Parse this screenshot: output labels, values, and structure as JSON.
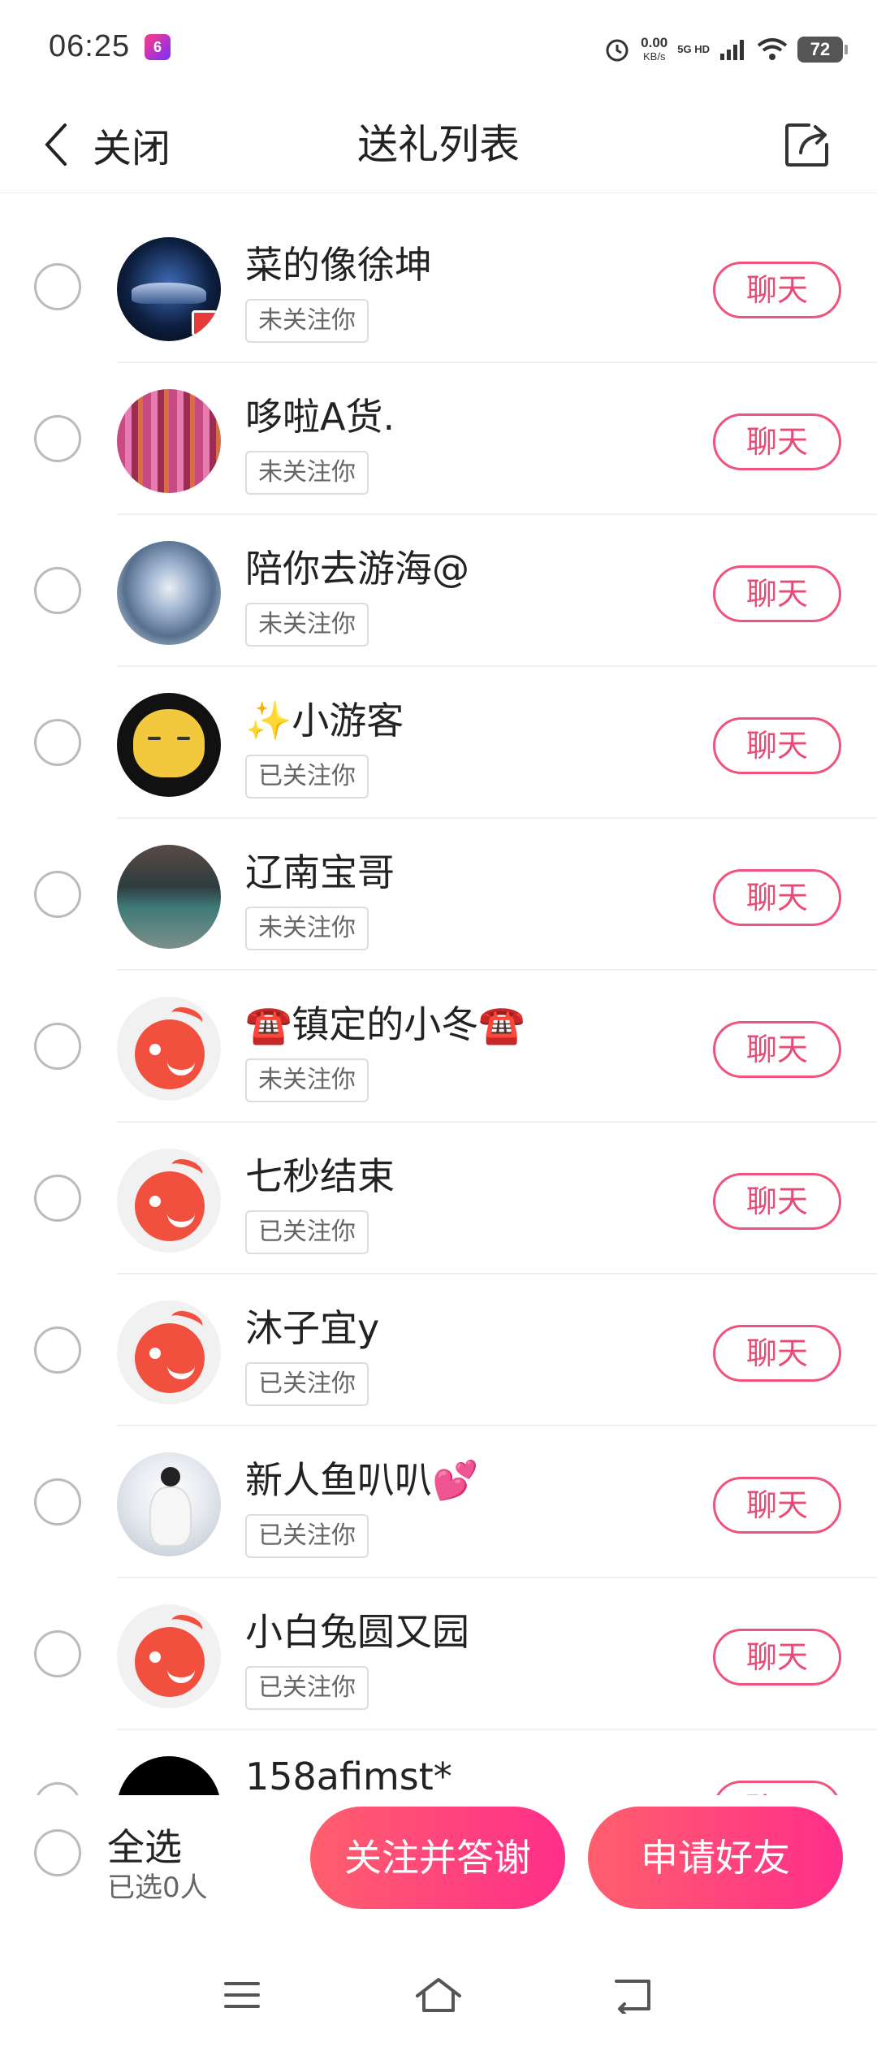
{
  "status_bar": {
    "time": "06:25",
    "app_icon_text": "6",
    "net_speed": "0.00",
    "net_unit": "KB/s",
    "network": "5G HD",
    "battery": "72"
  },
  "header": {
    "back_label": "关闭",
    "title": "送礼列表"
  },
  "list": {
    "chat_label": "聊天",
    "items": [
      {
        "name": "菜的像徐坤",
        "follow_status": "未关注你",
        "avatar": "car"
      },
      {
        "name": "哆啦A货.",
        "follow_status": "未关注你",
        "avatar": "curtain"
      },
      {
        "name": "陪你去游海@",
        "follow_status": "未关注你",
        "avatar": "sky"
      },
      {
        "name": "✨小游客",
        "follow_status": "已关注你",
        "avatar": "cat"
      },
      {
        "name": "辽南宝哥",
        "follow_status": "未关注你",
        "avatar": "street"
      },
      {
        "name": "☎️镇定的小冬☎️",
        "follow_status": "未关注你",
        "avatar": "default"
      },
      {
        "name": "七秒结束",
        "follow_status": "已关注你",
        "avatar": "default"
      },
      {
        "name": "沐子宜y",
        "follow_status": "已关注你",
        "avatar": "default"
      },
      {
        "name": "新人鱼叭叭💕",
        "follow_status": "已关注你",
        "avatar": "girl"
      },
      {
        "name": "小白兔圆又园",
        "follow_status": "已关注你",
        "avatar": "default"
      },
      {
        "name": "158afimst*",
        "follow_status": "",
        "avatar": "black"
      }
    ]
  },
  "bottom_bar": {
    "select_all_label": "全选",
    "selected_count": "已选0人",
    "follow_thank_button": "关注并答谢",
    "add_friend_button": "申请好友"
  },
  "colors": {
    "accent": "#f0547e",
    "button_gradient_start": "#ff5f6d",
    "button_gradient_end": "#ff2e8a"
  }
}
